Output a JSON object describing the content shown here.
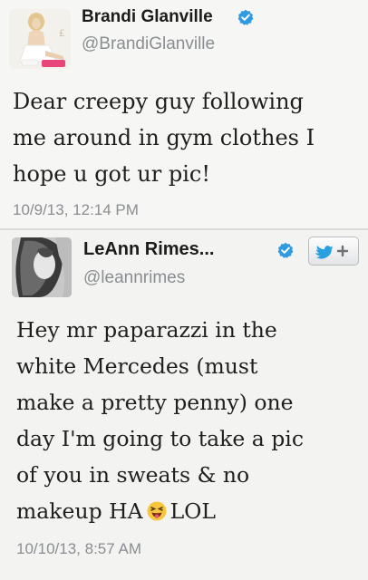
{
  "tweets": [
    {
      "display_name": "Brandi Glanville",
      "handle": "@BrandiGlanville",
      "verified": true,
      "text": "Dear creepy guy following\nme around in gym clothes I\nhope u got ur pic!",
      "timestamp": "10/9/13, 12:14 PM",
      "avatar_icon": "profile-photo"
    },
    {
      "display_name": "LeAnn Rimes...",
      "handle": "@leannrimes",
      "verified": true,
      "text_before_emoji": "Hey mr paparazzi in the\nwhite Mercedes (must\nmake a pretty penny) one\nday I'm going to take a pic\nof you in sweats & no\nmakeup HA",
      "text_after_emoji": "LOL",
      "emoji": "laughing-tongue-emoji",
      "timestamp": "10/10/13, 8:57 AM",
      "avatar_icon": "profile-photo",
      "follow_button_icon": "bird-plus-icon"
    }
  ],
  "colors": {
    "verified_blue": "#2f9ae0",
    "handle_gray": "#8a8d91"
  }
}
